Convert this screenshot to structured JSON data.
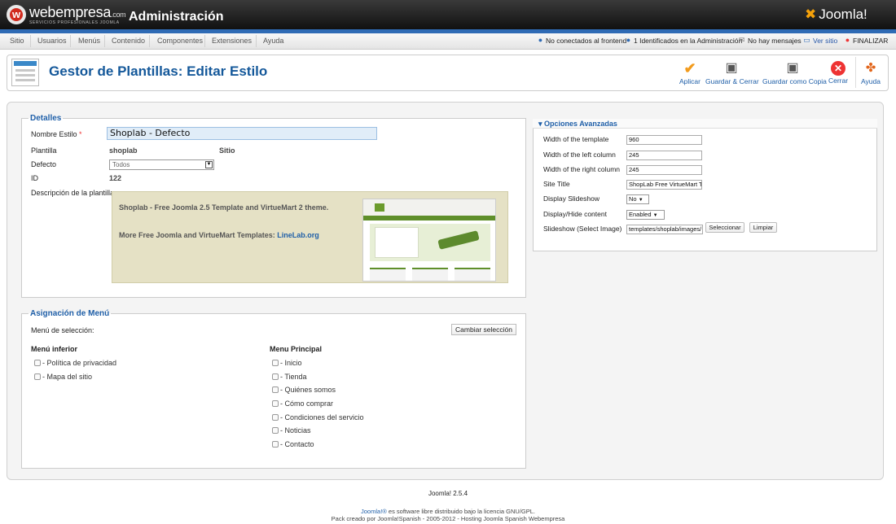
{
  "topbar": {
    "brand": "webempresa",
    "brand_com": ".com",
    "brand_sub": "SERVICIOS PROFESIONALES JOOMLA",
    "admin_title": "Administración",
    "joomla": "Joomla!"
  },
  "menu": {
    "items": [
      "Sitio",
      "Usuarios",
      "Menús",
      "Contenido",
      "Componentes",
      "Extensiones",
      "Ayuda"
    ]
  },
  "status": {
    "frontend": "No conectados al frontend",
    "admin": "1 Identificados en la Administración",
    "messages": "No hay mensajes",
    "ver_sitio": "Ver sitio",
    "finalizar": "FINALIZAR"
  },
  "toolbar": {
    "title": "Gestor de Plantillas: Editar Estilo",
    "buttons": {
      "aplicar": "Aplicar",
      "guardar_cerrar": "Guardar & Cerrar",
      "guardar_copia": "Guardar como Copia",
      "cerrar": "Cerrar",
      "ayuda": "Ayuda"
    }
  },
  "detalles": {
    "legend": "Detalles",
    "nombre_label": "Nombre Estilo",
    "nombre_value": "Shoplab - Defecto",
    "plantilla_label": "Plantilla",
    "plantilla_value": "shoplab",
    "plantilla_side": "Sitio",
    "defecto_label": "Defecto",
    "defecto_value": "Todos",
    "id_label": "ID",
    "id_value": "122",
    "descripcion_label": "Descripción de la plantilla",
    "desc_line1": "Shoplab - Free Joomla 2.5 Template and VirtueMart 2 theme.",
    "desc_line2_prefix": "More Free Joomla and VirtueMart Templates: ",
    "desc_link": "LineLab.org"
  },
  "asignacion": {
    "legend": "Asignación de Menú",
    "seleccion_label": "Menú de selección:",
    "cambiar_button": "Cambiar selección",
    "menu_inferior": {
      "title": "Menú inferior",
      "items": [
        "- Política de privacidad",
        "- Mapa del sitio"
      ]
    },
    "menu_principal": {
      "title": "Menu Principal",
      "items": [
        "- Inicio",
        "- Tienda",
        "- Quiénes somos",
        "- Cómo comprar",
        "- Condiciones del servicio",
        "- Noticias",
        "- Contacto"
      ]
    }
  },
  "avanzadas": {
    "title": "Opciones Avanzadas",
    "fields": [
      {
        "label": "Width of the template",
        "value": "960"
      },
      {
        "label": "Width of the left column",
        "value": "245"
      },
      {
        "label": "Width of the right column",
        "value": "245"
      },
      {
        "label": "Site Title",
        "value": "ShopLab Free VirtueMart Th"
      },
      {
        "label": "Display Slideshow",
        "value": "No"
      },
      {
        "label": "Display/Hide content",
        "value": "Enabled"
      },
      {
        "label": "Slideshow (Select Image)",
        "value": "templates/shoplab/images/"
      }
    ],
    "seleccionar": "Seleccionar",
    "limpiar": "Limpiar"
  },
  "footer": {
    "version": "Joomla! 2.5.4",
    "license_link": "Joomla!®",
    "license_text": " es software libre distribuido bajo la licencia GNU/GPL.",
    "pack_text": "Pack creado por Joomla!Spanish - 2005-2012 - Hosting Joomla Spanish Webempresa"
  },
  "colors": {
    "accent_blue": "#1f5fa8",
    "stripe_blue": "#2f6bb5",
    "brand_red": "#d12b1f",
    "aplicar_orange": "#f29b1d"
  }
}
